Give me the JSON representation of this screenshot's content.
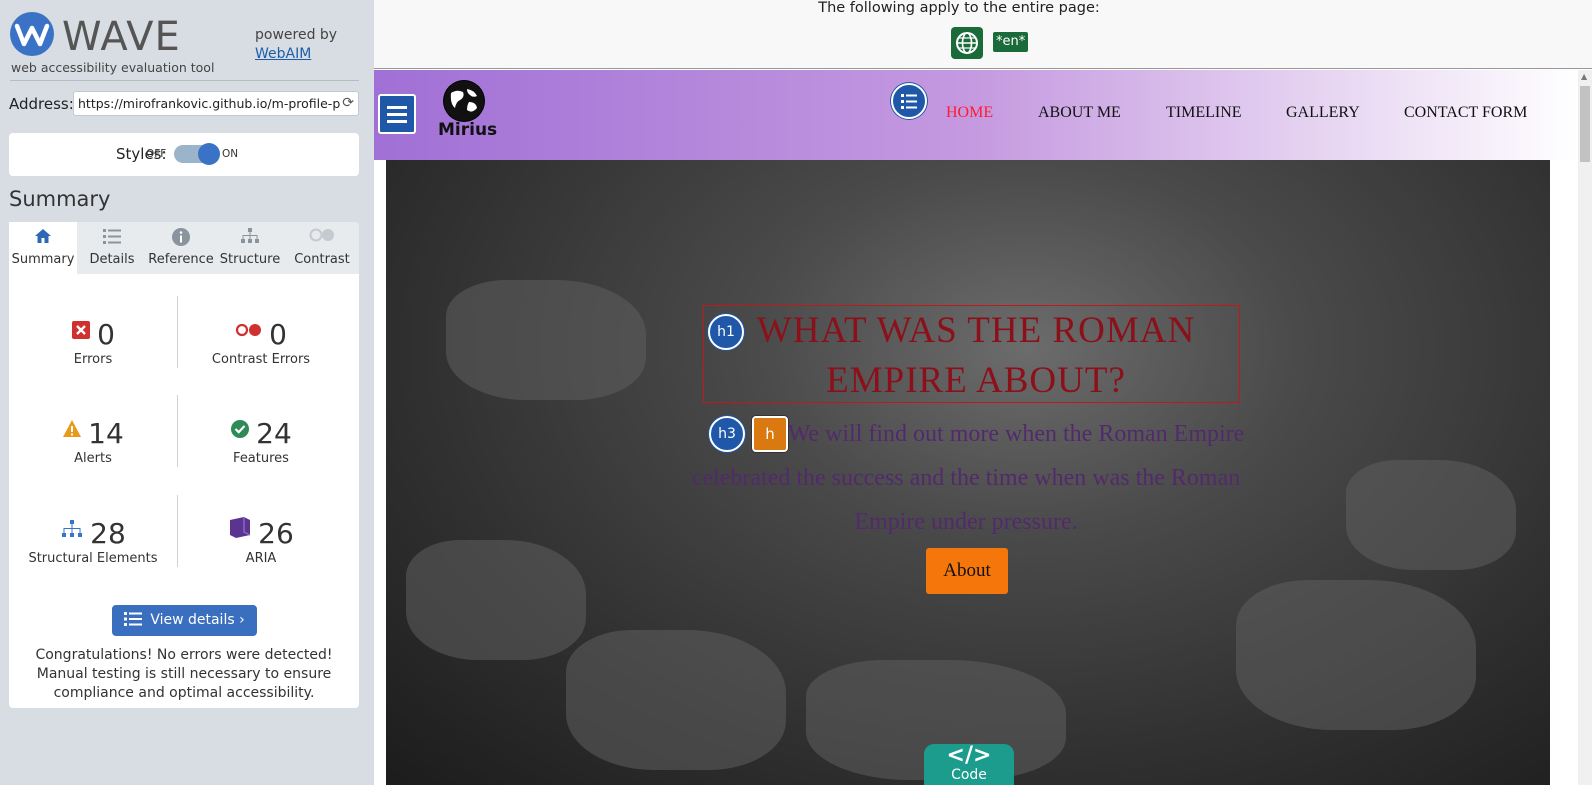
{
  "sidebar": {
    "title": "WAVE",
    "subtitle": "web accessibility evaluation tool",
    "powered_by": "powered by",
    "webaim_link": "WebAIM",
    "address_label": "Address:",
    "address_value": "https://mirofrankovic.github.io/m-profile-pro",
    "styles_label": "Styles:",
    "styles_off": "OFF",
    "styles_on": "ON",
    "summary_heading": "Summary",
    "tabs": [
      {
        "label": "Summary",
        "icon": "home-icon",
        "active": true
      },
      {
        "label": "Details",
        "icon": "list-icon"
      },
      {
        "label": "Reference",
        "icon": "info-icon"
      },
      {
        "label": "Structure",
        "icon": "structure-icon"
      },
      {
        "label": "Contrast",
        "icon": "contrast-icon"
      }
    ],
    "stats": [
      {
        "value": "0",
        "label": "Errors",
        "icon": "error-icon",
        "color": "#d03030"
      },
      {
        "value": "0",
        "label": "Contrast Errors",
        "icon": "contrast-error-icon",
        "color": "#d03030"
      },
      {
        "value": "14",
        "label": "Alerts",
        "icon": "alert-icon",
        "color": "#e89b1a"
      },
      {
        "value": "24",
        "label": "Features",
        "icon": "feature-icon",
        "color": "#2e8b57"
      },
      {
        "value": "28",
        "label": "Structural Elements",
        "icon": "structure-icon",
        "color": "#3a73c5"
      },
      {
        "value": "26",
        "label": "ARIA",
        "icon": "aria-icon",
        "color": "#5a3490"
      }
    ],
    "view_details": "View details ›",
    "congrats": "Congratulations! No errors were detected! Manual testing is still necessary to ensure compliance and optimal accessibility."
  },
  "page": {
    "apply_text": "The following apply to the entire page:",
    "lang_badge": "*en*",
    "brand": "Mirius",
    "nav": [
      {
        "label": "HOME",
        "active": true
      },
      {
        "label": "ABOUT ME"
      },
      {
        "label": "TIMELINE"
      },
      {
        "label": "GALLERY"
      },
      {
        "label": "CONTACT FORM"
      }
    ],
    "hero_title": "WHAT WAS THE ROMAN EMPIRE ABOUT?",
    "hero_text": "We will find out more when the Roman Empire celebrated the success and the time when was the Roman Empire under pressure.",
    "about_button": "About",
    "h1_marker": "h1",
    "h3_marker": "h3",
    "h_marker": "h",
    "code_tab_symbol": "</>",
    "code_tab_label": "Code"
  },
  "colors": {
    "wave_blue": "#3a73c5",
    "nav_gradient_start": "#a070d6",
    "nav_active": "#ff1a2e",
    "hero_title": "#8c1019",
    "about_button": "#f5760a",
    "code_tab": "#1b9c8c"
  }
}
